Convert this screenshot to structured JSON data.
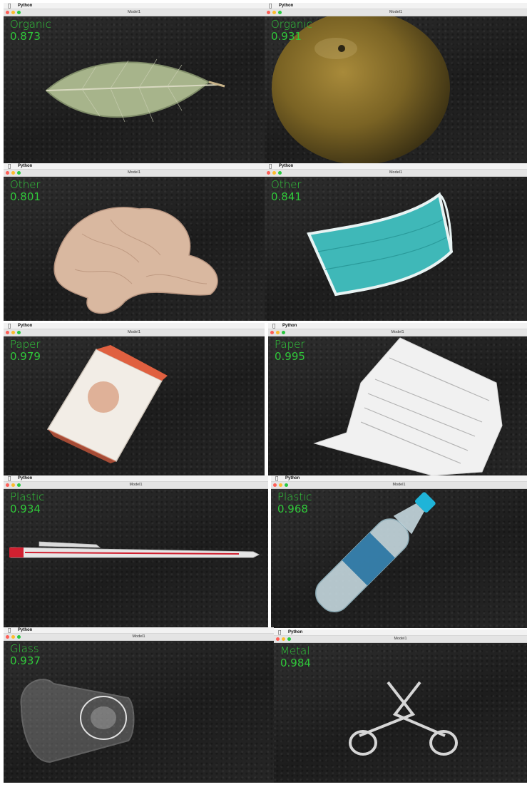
{
  "colors": {
    "label_green": "#30c83a",
    "close": "#ff5f57",
    "minimize": "#febc2e",
    "zoom": "#28c840"
  },
  "windows": [
    {
      "app": "Python",
      "title": "Model1",
      "label": "Organic",
      "score": "0.873",
      "object": "leaf"
    },
    {
      "app": "Python",
      "title": "Model1",
      "label": "Organic",
      "score": "0.931",
      "object": "orange"
    },
    {
      "app": "Python",
      "title": "Model1",
      "label": "Other",
      "score": "0.801",
      "object": "tissue"
    },
    {
      "app": "Python",
      "title": "Model1",
      "label": "Other",
      "score": "0.841",
      "object": "face-mask"
    },
    {
      "app": "Python",
      "title": "Model1",
      "label": "Paper",
      "score": "0.979",
      "object": "box"
    },
    {
      "app": "Python",
      "title": "Model1",
      "label": "Paper",
      "score": "0.995",
      "object": "receipt"
    },
    {
      "app": "Python",
      "title": "Model1",
      "label": "Plastic",
      "score": "0.934",
      "object": "pen"
    },
    {
      "app": "Python",
      "title": "Model1",
      "label": "Plastic",
      "score": "0.968",
      "object": "bottle"
    },
    {
      "app": "Python",
      "title": "Model1",
      "label": "Glass",
      "score": "0.937",
      "object": "glass"
    },
    {
      "app": "Python",
      "title": "Model1",
      "label": "Metal",
      "score": "0.984",
      "object": "scissors"
    }
  ]
}
